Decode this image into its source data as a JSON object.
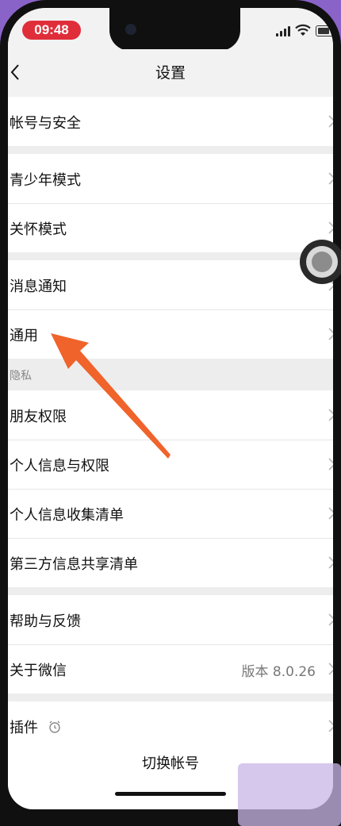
{
  "status_bar": {
    "time": "09:48"
  },
  "nav": {
    "title": "设置"
  },
  "groups": [
    {
      "items": [
        {
          "label": "帐号与安全"
        }
      ]
    },
    {
      "items": [
        {
          "label": "青少年模式"
        },
        {
          "label": "关怀模式"
        }
      ]
    },
    {
      "items": [
        {
          "label": "消息通知"
        },
        {
          "label": "通用"
        }
      ]
    },
    {
      "section_label": "隐私",
      "items": [
        {
          "label": "朋友权限"
        },
        {
          "label": "个人信息与权限"
        },
        {
          "label": "个人信息收集清单"
        },
        {
          "label": "第三方信息共享清单"
        }
      ]
    },
    {
      "items": [
        {
          "label": "帮助与反馈"
        },
        {
          "label": "关于微信",
          "value": "版本 8.0.26"
        }
      ]
    },
    {
      "items": [
        {
          "label": "插件"
        }
      ]
    }
  ],
  "footer": {
    "switch_account": "切换帐号"
  },
  "colors": {
    "accent_arrow": "#f0632b",
    "time_pill": "#e02d3a"
  }
}
